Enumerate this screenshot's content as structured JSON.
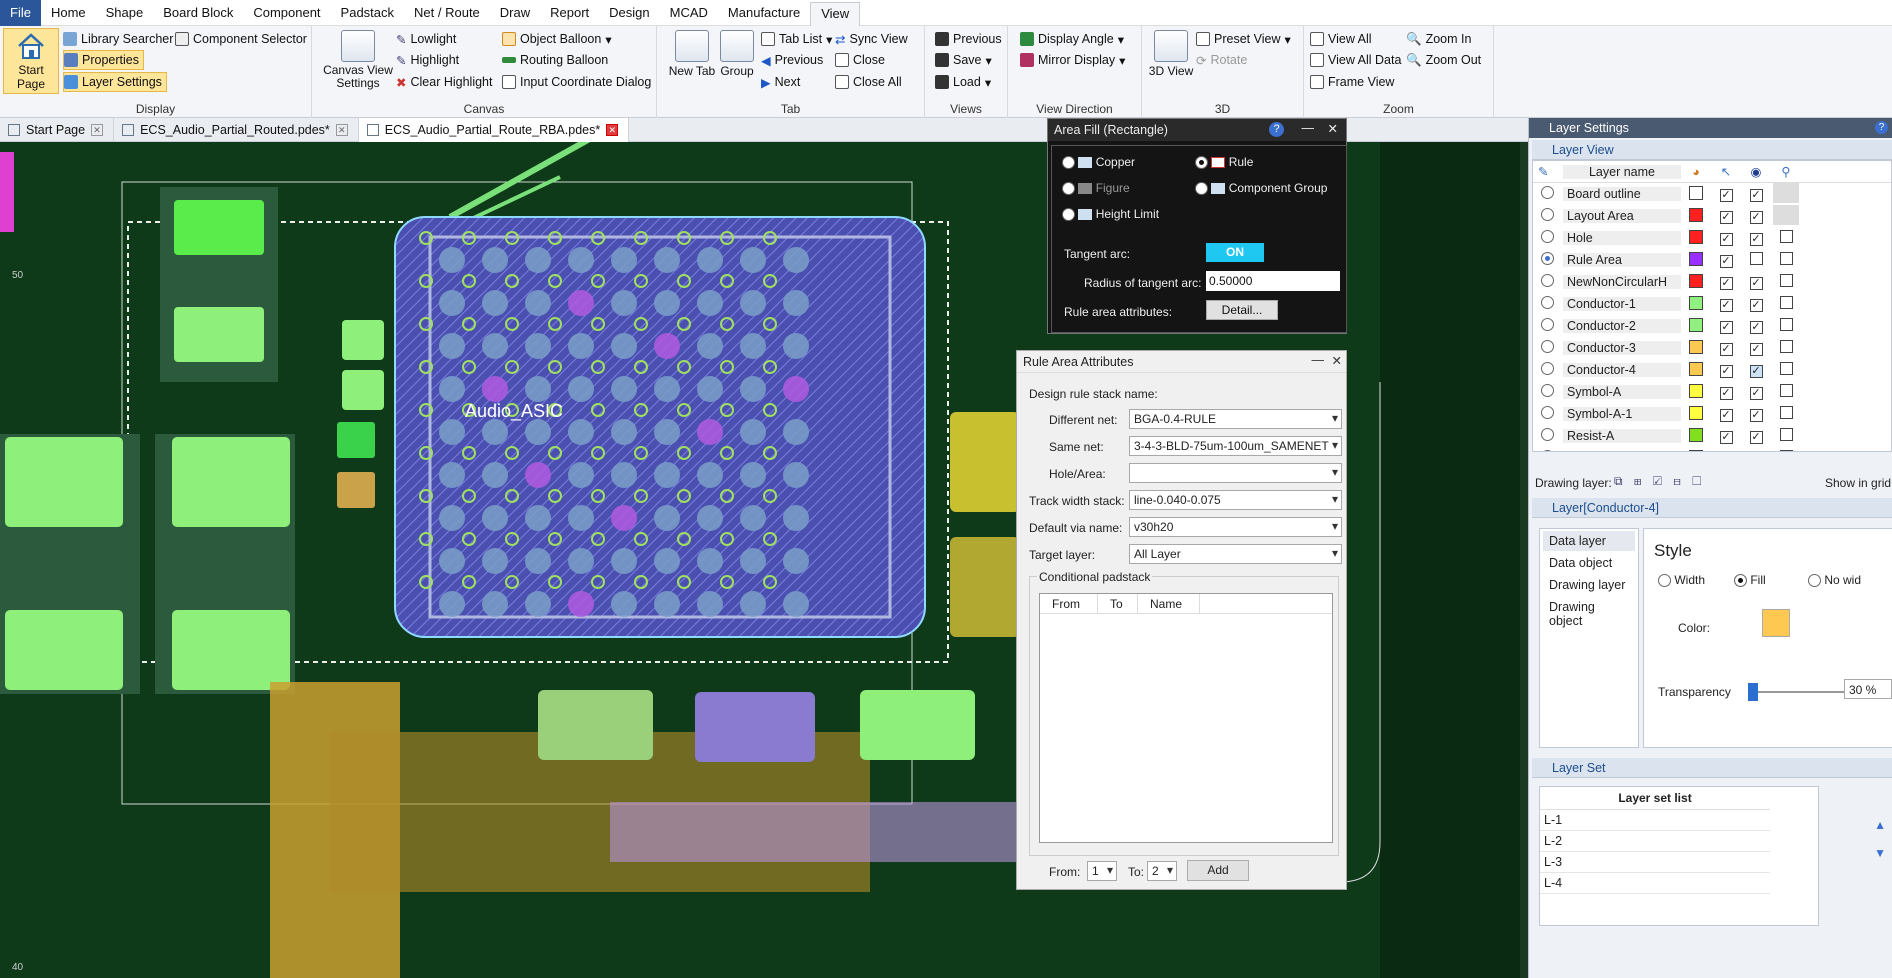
{
  "menu": [
    "File",
    "Home",
    "Shape",
    "Board Block",
    "Component",
    "Padstack",
    "Net / Route",
    "Draw",
    "Report",
    "Design",
    "MCAD",
    "Manufacture",
    "View"
  ],
  "ribbon": {
    "display": {
      "label": "Display",
      "start_page": "Start Page",
      "library_searcher": "Library Searcher",
      "component_selector": "Component Selector",
      "properties": "Properties",
      "layer_settings": "Layer Settings"
    },
    "canvas": {
      "label": "Canvas",
      "canvas_view_settings": "Canvas View Settings",
      "lowlight": "Lowlight",
      "highlight": "Highlight",
      "clear_highlight": "Clear Highlight",
      "object_balloon": "Object Balloon",
      "routing_balloon": "Routing Balloon",
      "input_coordinate": "Input Coordinate Dialog"
    },
    "tab": {
      "label": "Tab",
      "new_tab": "New Tab",
      "group": "Group",
      "tab_list": "Tab List",
      "previous": "Previous",
      "next": "Next",
      "sync_view": "Sync View",
      "close": "Close",
      "close_all": "Close All"
    },
    "views": {
      "label": "Views",
      "previous": "Previous",
      "save": "Save",
      "load": "Load"
    },
    "view_direction": {
      "label": "View Direction",
      "display_angle": "Display Angle",
      "mirror_display": "Mirror Display"
    },
    "three_d": {
      "label": "3D",
      "view_3d": "3D View",
      "preset_view": "Preset View",
      "rotate": "Rotate"
    },
    "zoom": {
      "label": "Zoom",
      "view_all": "View All",
      "view_all_data": "View All Data",
      "frame_view": "Frame View",
      "zoom_in": "Zoom In",
      "zoom_out": "Zoom Out"
    }
  },
  "tabs": [
    {
      "label": "Start Page"
    },
    {
      "label": "ECS_Audio_Partial_Routed.pdes*"
    },
    {
      "label": "ECS_Audio_Partial_Route_RBA.pdes*"
    }
  ],
  "canvas": {
    "component_label": "Audio_ASIC",
    "edge_label": "50",
    "bottom_label": "40"
  },
  "area_fill": {
    "title": "Area Fill (Rectangle)",
    "copper": "Copper",
    "rule": "Rule",
    "figure": "Figure",
    "component_group": "Component Group",
    "height_limit": "Height Limit",
    "tangent_arc": "Tangent arc:",
    "tangent_state": "ON",
    "radius_label": "Radius of tangent arc:",
    "radius_value": "0.50000",
    "rule_attrs": "Rule area attributes:",
    "detail": "Detail..."
  },
  "rule_attrs": {
    "title": "Rule Area Attributes",
    "stack_name": "Design rule stack name:",
    "different_net": "Different net:",
    "different_net_value": "BGA-0.4-RULE",
    "same_net": "Same net:",
    "same_net_value": "3-4-3-BLD-75um-100um_SAMENET",
    "hole_area": "Hole/Area:",
    "hole_area_value": "",
    "track_width": "Track width stack:",
    "track_width_value": "line-0.040-0.075",
    "default_via": "Default via name:",
    "default_via_value": "v30h20",
    "target_layer": "Target layer:",
    "target_layer_value": "All Layer",
    "conditional": "Conditional padstack",
    "col_from": "From",
    "col_to": "To",
    "col_name": "Name",
    "from_label": "From:",
    "from_value": "1",
    "to_label": "To:",
    "to_value": "2",
    "add": "Add"
  },
  "layer_settings": {
    "title": "Layer Settings",
    "layer_view": "Layer View",
    "col_name": "Layer name",
    "layers": [
      {
        "name": "Board outline",
        "color": "#ffffff",
        "sel": true,
        "vis": true,
        "extra": "grey"
      },
      {
        "name": "Layout Area",
        "color": "#ff2020",
        "sel": true,
        "vis": true,
        "extra": "grey"
      },
      {
        "name": "Hole",
        "color": "#ff2020",
        "sel": true,
        "vis": true,
        "extra": "box"
      },
      {
        "name": "Rule Area",
        "color": "#9a30ff",
        "sel": true,
        "vis": false,
        "extra": "box"
      },
      {
        "name": "NewNonCircularH",
        "color": "#ff2020",
        "sel": true,
        "vis": true,
        "extra": "box"
      },
      {
        "name": "Conductor-1",
        "color": "#90f080",
        "sel": true,
        "vis": true,
        "extra": "box"
      },
      {
        "name": "Conductor-2",
        "color": "#90f080",
        "sel": true,
        "vis": true,
        "extra": "box"
      },
      {
        "name": "Conductor-3",
        "color": "#ffc850",
        "sel": true,
        "vis": true,
        "extra": "box"
      },
      {
        "name": "Conductor-4",
        "color": "#ffc850",
        "sel": true,
        "vis": true,
        "extra": "box"
      },
      {
        "name": "Symbol-A",
        "color": "#ffff40",
        "sel": true,
        "vis": true,
        "extra": "box"
      },
      {
        "name": "Symbol-A-1",
        "color": "#ffff40",
        "sel": true,
        "vis": true,
        "extra": "box"
      },
      {
        "name": "Resist-A",
        "color": "#80e020",
        "sel": true,
        "vis": true,
        "extra": "box"
      },
      {
        "name": "MetalMask-A",
        "color": "#ff3080",
        "sel": true,
        "vis": true,
        "extra": "box"
      }
    ],
    "drawing_layer": "Drawing layer:",
    "show_in_grid": "Show in grid",
    "layer_props_title": "Layer[Conductor-4]",
    "nav": [
      "Data layer",
      "Data object",
      "Drawing layer",
      "Drawing object"
    ],
    "style": "Style",
    "width": "Width",
    "fill": "Fill",
    "no_wid": "No wid",
    "color_label": "Color:",
    "color": "#ffc850",
    "transparency": "Transparency",
    "transparency_value": "30 %",
    "layer_set": "Layer Set",
    "layer_set_list": "Layer set list",
    "layer_set_items": [
      "L-1",
      "L-2",
      "L-3",
      "L-4"
    ]
  }
}
